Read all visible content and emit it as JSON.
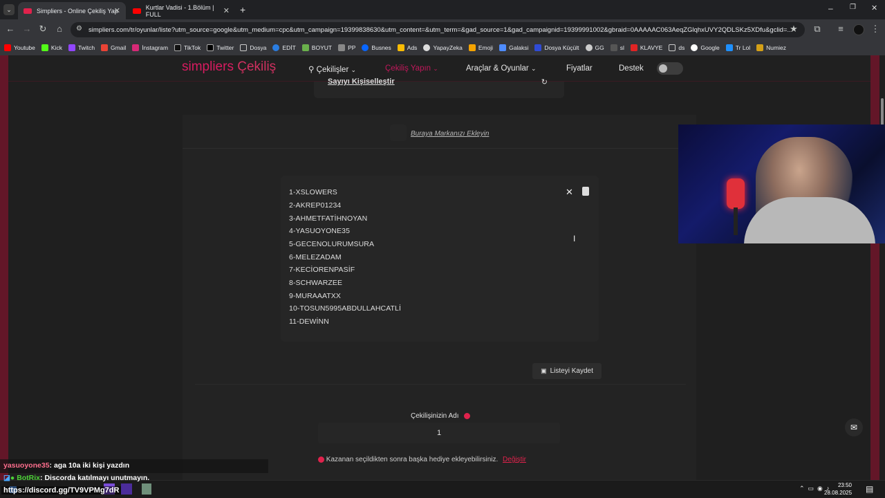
{
  "browser": {
    "tabs": [
      {
        "title": "Simpliers - Online Çekiliş Yap",
        "active": true
      },
      {
        "title": "Kurtlar Vadisi - 1.Bölüm | FULL",
        "active": false
      }
    ],
    "url": "simpliers.com/tr/oyunlar/liste?utm_source=google&utm_medium=cpc&utm_campaign=19399838630&utm_content=&utm_term=&gad_source=1&gad_campaignid=19399991002&gbraid=0AAAAAC063AeqZGlqhxUVY2QDLSKz5XDfu&gclid=...",
    "bookmarks": [
      "Youtube",
      "Kick",
      "Twitch",
      "Gmail",
      "İnstagram",
      "TikTok",
      "Twitter",
      "Dosya",
      "EDİT",
      "BOYUT",
      "PP",
      "Busnes",
      "Ads",
      "YapayZeka",
      "Emoji",
      "Galaksi",
      "Dosya Küçült",
      "GG",
      "sl",
      "KLAVYE",
      "ds",
      "Google",
      "Tr Lol",
      "Numiez"
    ]
  },
  "site": {
    "logo_main": "simpliers",
    "logo_accent": "Çekiliş",
    "nav": {
      "raffles": "Çekilişler",
      "make_raffle": "Çekiliş Yapın",
      "tools_games": "Araçlar & Oyunlar",
      "pricing": "Fiyatlar",
      "support": "Destek"
    },
    "top_card_label": "Sayıyı Kişiselleştir",
    "brand_link": "Buraya Markanızı Ekleyin",
    "list": [
      "1-XSLOWERS",
      "2-AKREP01234",
      "3-AHMETFATİHNOYAN",
      "4-YASUOYONE35",
      "5-GECENOLURUMSURA",
      "6-MELEZADAM",
      "7-KECİORENPASİF",
      "8-SCHWARZEE",
      "9-MURAAATXX",
      "10-TOSUN5995ABDULLAHCATLİ",
      "11-DEWİNN"
    ],
    "save_button": "Listeyi Kaydet",
    "raffle_name_label": "Çekilişinizin Adı",
    "raffle_name_value": "1",
    "note_text": "Kazanan seçildikten sonra başka hediye ekleyebilirsiniz.",
    "note_link": "Değiştir"
  },
  "stream": {
    "chat_user": "yasuoyone35",
    "chat_message": ": aga 10a iki kişi yazdın",
    "bot_user": "BotRix",
    "bot_message": ": Discorda katılmayı unutmayın.",
    "discord_link": "https://discord.gg/TV9VPMg7dR"
  },
  "taskbar": {
    "time": "23:50",
    "date": "28.08.2025"
  },
  "colors": {
    "accent": "#d81b60",
    "page_bg": "#631628",
    "panel_bg": "#232323"
  }
}
